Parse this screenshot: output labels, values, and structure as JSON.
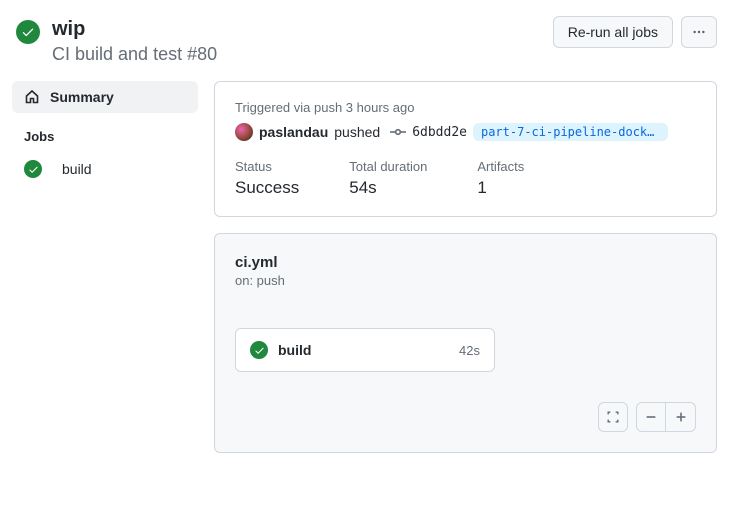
{
  "header": {
    "title": "wip",
    "subtitle": "CI build and test #80",
    "rerun_label": "Re-run all jobs"
  },
  "sidebar": {
    "summary_label": "Summary",
    "jobs_heading": "Jobs",
    "jobs": [
      {
        "name": "build"
      }
    ]
  },
  "trigger": {
    "line": "Triggered via push 3 hours ago",
    "actor": "paslandau",
    "action": "pushed",
    "sha": "6dbdd2e",
    "branch": "part-7-ci-pipeline-docker-p…"
  },
  "stats": {
    "status_label": "Status",
    "status_value": "Success",
    "duration_label": "Total duration",
    "duration_value": "54s",
    "artifacts_label": "Artifacts",
    "artifacts_value": "1"
  },
  "workflow": {
    "file": "ci.yml",
    "on": "on: push",
    "job": {
      "name": "build",
      "duration": "42s"
    }
  }
}
